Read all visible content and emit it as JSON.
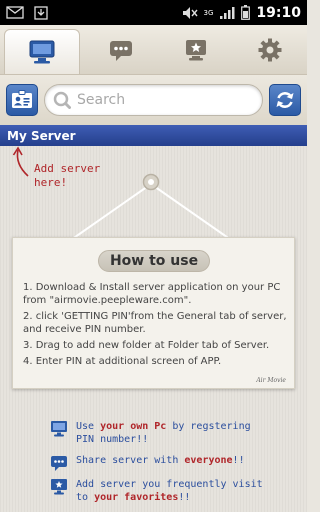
{
  "status_bar": {
    "time": "19:10",
    "network": "3G"
  },
  "tabs": [
    {
      "name": "tab-server",
      "icon": "monitor-icon",
      "active": true
    },
    {
      "name": "tab-messages",
      "icon": "chat-icon",
      "active": false
    },
    {
      "name": "tab-favorites",
      "icon": "star-icon",
      "active": false
    },
    {
      "name": "tab-settings",
      "icon": "gear-icon",
      "active": false
    }
  ],
  "search": {
    "placeholder": "Search"
  },
  "section": {
    "title": "My Server"
  },
  "hint": {
    "add_server": "Add server here!"
  },
  "howto": {
    "title": "How to use",
    "steps": [
      "1. Download & Install server application on your PC from \"airmovie.peepleware.com\".",
      "2. click 'GETTING PIN'from the General tab of server, and receive PIN number.",
      "3. Drag to add new folder at Folder tab of Server.",
      "4. Enter PIN at additional screen of APP."
    ],
    "signature": "Air Movie"
  },
  "features": [
    {
      "pre": "Use ",
      "highlight": "your own Pc",
      "post": " by regstering PIN number!!"
    },
    {
      "pre": "Share server with ",
      "highlight": "everyone",
      "post": "!!"
    },
    {
      "pre": "Add server you frequently visit to ",
      "highlight": "your favorites",
      "post": "!!"
    }
  ],
  "colors": {
    "accent": "#2b5aa5",
    "header": "#2f4a9c",
    "hint_red": "#b0262a",
    "feature_blue": "#2c4f9e"
  }
}
